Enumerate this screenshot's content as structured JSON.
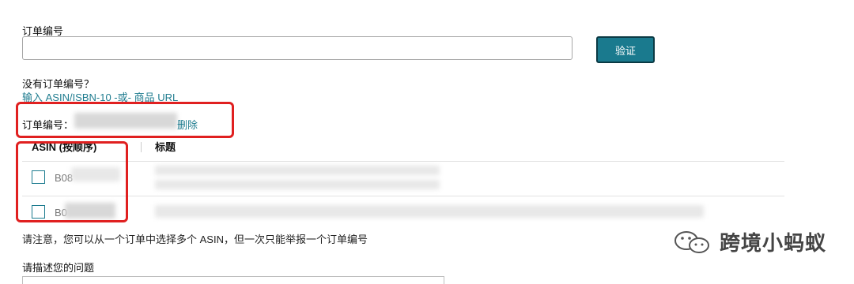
{
  "order_section": {
    "label": "订单编号",
    "input_value": "",
    "verify_button": "验证"
  },
  "no_order": {
    "question": "没有订单编号？",
    "alt_link": "输入 ASIN/ISBN-10 -或- 商品 URL"
  },
  "order_row": {
    "label": "订单编号：",
    "delete_link": "删除"
  },
  "table": {
    "col_asin": "ASIN (按顺序)",
    "col_title": "标题",
    "rows": [
      {
        "asin_prefix": "B08",
        "checked": false
      },
      {
        "asin_prefix": "B0",
        "checked": false
      }
    ]
  },
  "notice": "请注意，您可以从一个订单中选择多个 ASIN，但一次只能举报一个订单编号",
  "describe_label": "请描述您的问题",
  "watermark": {
    "text": "跨境小蚂蚁",
    "icon": "wechat-icon"
  }
}
